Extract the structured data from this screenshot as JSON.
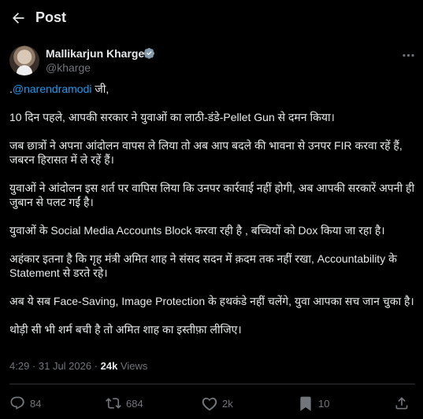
{
  "header": {
    "title": "Post"
  },
  "author": {
    "name": "Mallikarjun Kharge",
    "handle": "@kharge"
  },
  "tweet": {
    "mention": "@narendramodi",
    "mention_prefix": ".",
    "mention_suffix": " जी,",
    "paragraphs": [
      "10 दिन पहले, आपकी सरकार ने युवाओं का लाठी-डंडे-Pellet Gun से दमन किया।",
      "जब छात्रों ने अपना आंदोलन वापस ले लिया तो अब आप बदले की भावना से उनपर FIR करवा रहें हैं, जबरन हिरासत में ले रहें हैं।",
      "युवाओं ने आंदोलन इस शर्त पर वापिस लिया कि उनपर कार्रवाई नहीं होगी, अब आपकी सरकारें अपनी ही जुबान से पलट गईं है।",
      "युवाओं के Social Media Accounts Block करवा रही है , बच्चियों को Dox किया जा रहा है।",
      "अहंकार इतना है कि गृह मंत्री अमित शाह ने संसद सदन में क़दम तक नहीं रखा, Accountability के Statement से डरते रहे।",
      "अब ये सब Face-Saving, Image Protection के हथकंडे नहीं चलेंगे, युवा आपका सच जान चुका है।",
      "थोड़ी सी भी शर्म बची है तो अमित शाह का इस्तीफ़ा लीजिए।"
    ]
  },
  "meta": {
    "time": "4:29",
    "separator": " · ",
    "date": "31 Jul 2026",
    "separator2": " · ",
    "views_count": "24k",
    "views_label": " Views"
  },
  "actions": {
    "replies": "84",
    "reposts": "684",
    "likes": "2k",
    "bookmarks": "10"
  },
  "colors": {
    "accent": "#1d9bf0",
    "muted": "#71767b",
    "text": "#e7e9ea",
    "bg": "#000000"
  }
}
